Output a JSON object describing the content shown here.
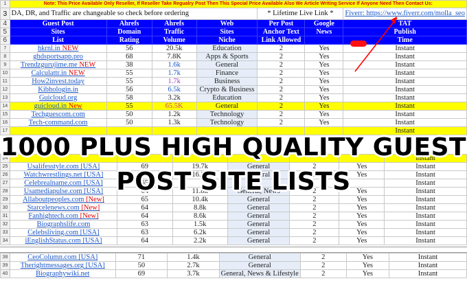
{
  "banner": "Note: This Price Available Only Reseller, If Reseller Take Regualry Post Then This Special Price Available Also We Article Writing Service If Anyone Need Then Contact Us:",
  "info": {
    "note": "DA, DR, and Traffic are changeable so check before ordering",
    "lifetime": "* Lifetime Live Link *",
    "fiverr": "Fiverr: https://www.fiverr.com/molla_seo"
  },
  "headers": {
    "row4": [
      "Guest Post",
      "Ahrefs",
      "Ahrefs",
      "Web",
      "Per Post",
      "Google",
      "TAT"
    ],
    "row5": [
      "Sites",
      "Domain",
      "Traffic",
      "Sites",
      "Anchor Text",
      "News",
      "Publish"
    ],
    "row6": [
      "List",
      "Rating",
      "Volume",
      "Niche",
      "Link Allowed",
      "",
      "Time"
    ]
  },
  "colors": {
    "header_blue": "#0000ff",
    "highlight_yellow": "#ffff00",
    "link_blue": "#1a56c8",
    "arrow_red": "#ff0000"
  },
  "rows_top": [
    {
      "n": "7",
      "site": "hkrnl.in",
      "tag": " NEW",
      "dr": "56",
      "traffic": "20.5k",
      "niche": "Education",
      "links": "2",
      "news": "Yes",
      "tat": "Instant"
    },
    {
      "n": "8",
      "site": "ghdsportsapp.pro",
      "tag": "",
      "dr": "68",
      "traffic": "7.8K",
      "niche": "Apps & Sports",
      "links": "2",
      "news": "Yes",
      "tat": "Instant"
    },
    {
      "n": "9",
      "site": "Trendzgurujime.me",
      "tag": " NEW",
      "dr": "38",
      "traffic": "1.6k",
      "niche": "General",
      "links": "2",
      "news": "Yes",
      "tat": "Instant"
    },
    {
      "n": "10",
      "site": "Calculattr.in",
      "tag": " NEW",
      "dr": "55",
      "traffic": "1.7k",
      "niche": "Finance",
      "links": "2",
      "news": "Yes",
      "tat": "Instant"
    },
    {
      "n": "11",
      "site": "How2invest.today",
      "tag": "",
      "dr": "55",
      "traffic": "1.7k",
      "niche": "Business",
      "links": "2",
      "news": "Yes",
      "tat": "Instant"
    },
    {
      "n": "12",
      "site": "Kibhologin.in",
      "tag": "",
      "dr": "56",
      "traffic": "6.5k",
      "niche": "Crypto & Business",
      "links": "2",
      "news": "Yes",
      "tat": "Instant"
    },
    {
      "n": "13",
      "site": "Guicloud.org",
      "tag": "",
      "dr": "58",
      "traffic": "3.2k",
      "niche": "Education",
      "links": "2",
      "news": "Yes",
      "tat": "Instant"
    },
    {
      "n": "14",
      "site": "guicloud.in",
      "tag": " New",
      "dr": "55",
      "traffic": "65.5K",
      "niche": "General",
      "links": "2",
      "news": "Yes",
      "tat": "Instant"
    },
    {
      "n": "15",
      "site": "Techguescom.com",
      "tag": "",
      "dr": "50",
      "traffic": "1.2k",
      "niche": "Technology",
      "links": "2",
      "news": "Yes",
      "tat": "Instant"
    },
    {
      "n": "16",
      "site": "Tech-command.com",
      "tag": "",
      "dr": "50",
      "traffic": "1.3k",
      "niche": "Technology",
      "links": "2",
      "news": "Yes",
      "tat": "Instant"
    },
    {
      "n": "17",
      "site": "",
      "tag": "",
      "dr": "",
      "traffic": "",
      "niche": "",
      "links": "",
      "news": "",
      "tat": "Instant"
    }
  ],
  "rows_mid": [
    {
      "n": "24",
      "site": "",
      "tag": "",
      "dr": "",
      "traffic": "",
      "niche": "",
      "links": "",
      "news": "",
      "tat": "Instant"
    },
    {
      "n": "25",
      "site": "Usalifesstyle.com",
      "tag": " [USA]",
      "dr": "69",
      "traffic": "19.7k",
      "niche": "General",
      "links": "2",
      "news": "Yes",
      "tat": "Instant"
    },
    {
      "n": "26",
      "site": "Watchwrestlings.net",
      "tag": " [USA]",
      "dr": "69",
      "traffic": "16.7k",
      "niche": "General",
      "links": "2",
      "news": "Yes",
      "tat": "Instant"
    },
    {
      "n": "27",
      "site": "Celebrealname.com",
      "tag": " [USA]",
      "dr": "65",
      "traffic": "",
      "niche": "",
      "links": "",
      "news": "",
      "tat": "Instant"
    },
    {
      "n": "28",
      "site": "Usamediapulse.com",
      "tag": " [USA]",
      "dr": "64",
      "traffic": "11.8k",
      "niche": "General, News",
      "links": "2",
      "news": "Yes",
      "tat": "Instant"
    },
    {
      "n": "29",
      "site": "Allaboutpeoples.com",
      "tag": " [New]",
      "dr": "65",
      "traffic": "10.4k",
      "niche": "General",
      "links": "2",
      "news": "Yes",
      "tat": "Instant"
    },
    {
      "n": "30",
      "site": "Starcelenews.com",
      "tag": " [New]",
      "dr": "64",
      "traffic": "8.8k",
      "niche": "General",
      "links": "2",
      "news": "Yes",
      "tat": "Instant"
    },
    {
      "n": "31",
      "site": "Fanhightech.com",
      "tag": " [New]",
      "dr": "64",
      "traffic": "8.6k",
      "niche": "General",
      "links": "2",
      "news": "Yes",
      "tat": "Instant"
    },
    {
      "n": "32",
      "site": "Biographslife.com",
      "tag": "",
      "dr": "63",
      "traffic": "1.5k",
      "niche": "General",
      "links": "2",
      "news": "Yes",
      "tat": "Instant"
    },
    {
      "n": "33",
      "site": "Celebsliving.com",
      "tag": " [USA]",
      "dr": "63",
      "traffic": "6.2k",
      "niche": "General",
      "links": "2",
      "news": "Yes",
      "tat": "Instant"
    },
    {
      "n": "34",
      "site": "iEnglishStatus.com",
      "tag": " [USA]",
      "dr": "64",
      "traffic": "2.2k",
      "niche": "General",
      "links": "2",
      "news": "Yes",
      "tat": "Instant"
    }
  ],
  "rows_bottom": [
    {
      "n": "38",
      "site": "CeoColumn.com",
      "tag": " [USA]",
      "dr": "71",
      "traffic": "1.4k",
      "niche": "General",
      "links": "2",
      "news": "Yes",
      "tat": "Instant"
    },
    {
      "n": "39",
      "site": "Therightmessages.org",
      "tag": " [USA]",
      "dr": "50",
      "traffic": "2.7k",
      "niche": "General",
      "links": "2",
      "news": "Yes",
      "tat": "Instant"
    },
    {
      "n": "40",
      "site": "Biographywiki.net",
      "tag": "",
      "dr": "69",
      "traffic": "3.7k",
      "niche": "General, News & Lifestyle",
      "links": "2",
      "news": "Yes",
      "tat": "Instant"
    }
  ],
  "overlay": {
    "line1": "1000 PLUS HIGH QUALITY GUEST",
    "line2": "POST SITE LISTS"
  }
}
